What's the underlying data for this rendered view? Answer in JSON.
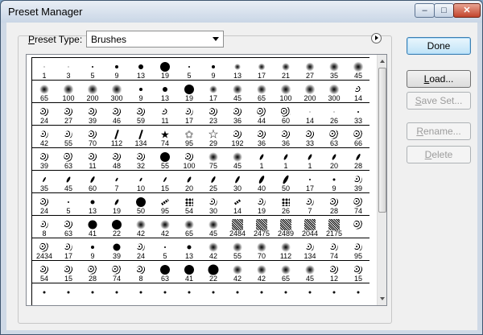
{
  "window": {
    "title": "Preset Manager"
  },
  "title_buttons": {
    "minimize": "–",
    "maximize": "□",
    "close": "✕"
  },
  "preset_type": {
    "label_mnemonic": "P",
    "label_rest": "reset Type:",
    "value": "Brushes"
  },
  "buttons": {
    "done": "Done",
    "load": {
      "mnemonic": "L",
      "rest": "oad..."
    },
    "save_set": {
      "mnemonic": "S",
      "rest": "ave Set..."
    },
    "rename": {
      "mnemonic": "R",
      "rest": "ename..."
    },
    "delete": {
      "mnemonic": "D",
      "rest": "elete"
    }
  },
  "brush_rows": [
    [
      "1",
      "3",
      "5",
      "9",
      "13",
      "19",
      "5",
      "9",
      "13",
      "17",
      "21",
      "27",
      "35",
      "45"
    ],
    [
      "65",
      "100",
      "200",
      "300",
      "9",
      "13",
      "19",
      "17",
      "45",
      "65",
      "100",
      "200",
      "300",
      "14"
    ],
    [
      "24",
      "27",
      "39",
      "46",
      "59",
      "11",
      "17",
      "23",
      "36",
      "44",
      "60",
      "14",
      "26",
      "33"
    ],
    [
      "42",
      "55",
      "70",
      "112",
      "134",
      "74",
      "95",
      "29",
      "192",
      "36",
      "36",
      "33",
      "63",
      "66"
    ],
    [
      "39",
      "63",
      "11",
      "48",
      "32",
      "55",
      "100",
      "75",
      "45",
      "1",
      "1",
      "1",
      "20",
      "28"
    ],
    [
      "35",
      "45",
      "60",
      "7",
      "10",
      "15",
      "20",
      "25",
      "30",
      "40",
      "50",
      "17",
      "9",
      "39"
    ],
    [
      "24",
      "5",
      "13",
      "19",
      "50",
      "95",
      "54",
      "30",
      "14",
      "19",
      "26",
      "7",
      "28",
      "74"
    ],
    [
      "8",
      "63",
      "41",
      "22",
      "42",
      "42",
      "65",
      "45",
      "2484",
      "2475",
      "2489",
      "2044",
      "2175",
      ""
    ],
    [
      "2434",
      "17",
      "9",
      "39",
      "24",
      "5",
      "13",
      "42",
      "55",
      "70",
      "112",
      "134",
      "74",
      "95"
    ],
    [
      "54",
      "15",
      "28",
      "74",
      "8",
      "63",
      "41",
      "22",
      "42",
      "42",
      "65",
      "45",
      "12",
      "15"
    ],
    [
      "",
      "",
      "",
      "",
      "",
      "",
      "",
      "",
      "",
      "",
      "",
      "",
      "",
      ""
    ]
  ],
  "brush_glyphs": [
    [
      "dot",
      "dot",
      "dot",
      "dot",
      "dot",
      "dot",
      "dot",
      "dot",
      "soft",
      "soft",
      "soft",
      "soft",
      "soft",
      "soft"
    ],
    [
      "soft",
      "soft",
      "soft",
      "soft",
      "dot",
      "dot",
      "dot",
      "soft",
      "soft",
      "soft",
      "soft",
      "soft",
      "soft",
      "spatter"
    ],
    [
      "spatter",
      "spatter",
      "spatter",
      "spatter",
      "spatter",
      "spatter",
      "spatter",
      "spatter",
      "spatter",
      "spatter",
      "spatter",
      "dot",
      "dot",
      "dot"
    ],
    [
      "spatter",
      "spatter",
      "spatter",
      "grass",
      "grass",
      "leaf",
      "leafgrey",
      "star",
      "spatter",
      "spatter",
      "spatter",
      "spatter",
      "spatter",
      "spatter"
    ],
    [
      "spatter",
      "spatter",
      "spatter",
      "spatter",
      "spatter",
      "dot",
      "spatter",
      "soft",
      "soft",
      "stroke",
      "stroke",
      "stroke",
      "stroke",
      "stroke"
    ],
    [
      "oval",
      "oval",
      "oval",
      "oval",
      "oval",
      "oval",
      "oval",
      "oval",
      "oval",
      "oval",
      "oval",
      "dot",
      "dot",
      "spatter"
    ],
    [
      "spatter",
      "dot",
      "dot",
      "stroke",
      "dot",
      "dotline",
      "dots",
      "spatter",
      "dotline",
      "spatter",
      "dots",
      "spatter",
      "spatter",
      "spatter"
    ],
    [
      "spatter",
      "spatter",
      "dot",
      "dot",
      "soft",
      "soft",
      "soft",
      "soft",
      "texture",
      "texture",
      "texture",
      "texture",
      "texture",
      "spatter"
    ],
    [
      "spatter",
      "spatter",
      "dot",
      "dot",
      "spatter",
      "dot",
      "dot",
      "soft",
      "soft",
      "soft",
      "soft",
      "spatter",
      "spatter",
      "spatter"
    ],
    [
      "spatter",
      "spatter",
      "spatter",
      "spatter",
      "spatter",
      "dot",
      "dot",
      "dot",
      "soft",
      "soft",
      "soft",
      "soft",
      "spatter",
      "spatter"
    ],
    [
      "dot",
      "dot",
      "dot",
      "dot",
      "dot",
      "dot",
      "dot",
      "dot",
      "dot",
      "dot",
      "dot",
      "dot",
      "dot",
      "dot"
    ]
  ],
  "brush_sizes": [
    [
      1,
      1,
      2,
      4,
      6,
      12,
      2,
      4,
      8,
      9,
      10,
      11,
      12,
      13
    ],
    [
      12,
      13,
      13,
      13,
      4,
      6,
      12,
      10,
      12,
      12,
      13,
      13,
      13,
      8
    ],
    [
      10,
      10,
      10,
      10,
      10,
      8,
      9,
      10,
      10,
      11,
      12,
      1,
      1,
      2
    ],
    [
      9,
      9,
      10,
      12,
      12,
      10,
      12,
      14,
      10,
      10,
      10,
      10,
      11,
      11
    ],
    [
      10,
      11,
      10,
      10,
      10,
      12,
      10,
      12,
      12,
      8,
      8,
      8,
      8,
      9
    ],
    [
      7,
      8,
      9,
      5,
      5,
      7,
      8,
      9,
      10,
      11,
      12,
      2,
      3,
      9
    ],
    [
      10,
      2,
      5,
      8,
      12,
      10,
      10,
      9,
      8,
      9,
      10,
      9,
      10,
      11
    ],
    [
      9,
      10,
      11,
      12,
      12,
      12,
      12,
      12,
      14,
      14,
      14,
      14,
      14,
      11
    ],
    [
      11,
      9,
      4,
      9,
      9,
      2,
      5,
      12,
      12,
      12,
      12,
      9,
      9,
      9
    ],
    [
      10,
      10,
      11,
      11,
      10,
      12,
      12,
      13,
      12,
      12,
      12,
      12,
      10,
      10
    ],
    [
      3,
      3,
      3,
      3,
      3,
      3,
      3,
      3,
      3,
      3,
      3,
      3,
      3,
      3
    ]
  ]
}
